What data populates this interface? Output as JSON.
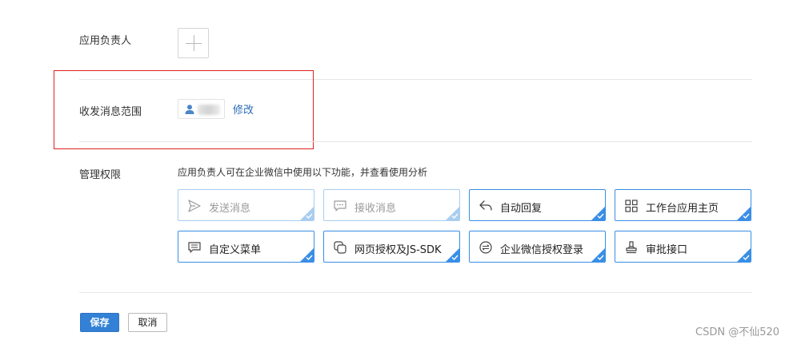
{
  "owner": {
    "label": "应用负责人",
    "add_icon": "plus-icon"
  },
  "scope": {
    "label": "收发消息范围",
    "member_icon": "person-icon",
    "modify_link": "修改"
  },
  "permissions": {
    "label": "管理权限",
    "description": "应用负责人可在企业微信中使用以下功能，并查看使用分析",
    "items": [
      {
        "label": "发送消息",
        "icon": "send-icon",
        "enabled": false
      },
      {
        "label": "接收消息",
        "icon": "chat-bubble-icon",
        "enabled": false
      },
      {
        "label": "自动回复",
        "icon": "reply-icon",
        "enabled": true
      },
      {
        "label": "工作台应用主页",
        "icon": "grid-icon",
        "enabled": true
      },
      {
        "label": "自定义菜单",
        "icon": "menu-icon",
        "enabled": true
      },
      {
        "label": "网页授权及JS-SDK",
        "icon": "copy-link-icon",
        "enabled": true
      },
      {
        "label": "企业微信授权登录",
        "icon": "login-icon",
        "enabled": true
      },
      {
        "label": "审批接口",
        "icon": "stamp-icon",
        "enabled": true
      }
    ]
  },
  "actions": {
    "save": "保存",
    "cancel": "取消"
  },
  "watermark": "CSDN @不仙520",
  "colors": {
    "accent": "#3a8ee6",
    "link": "#2a6bb7",
    "highlight": "#e02020",
    "primary_button": "#3381d6"
  }
}
